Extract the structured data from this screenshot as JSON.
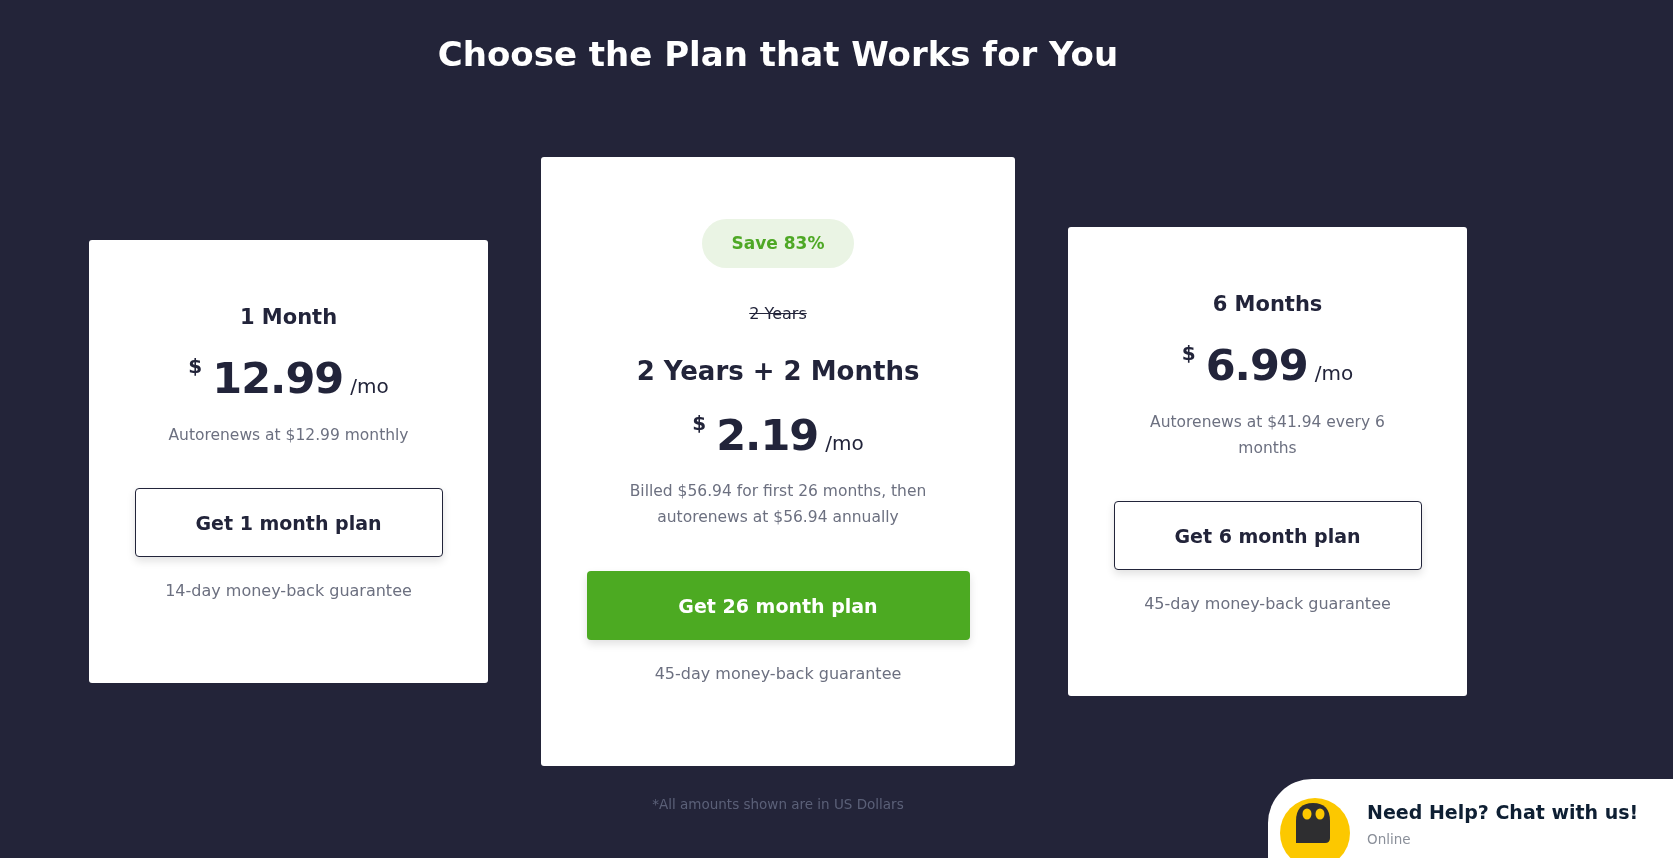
{
  "page": {
    "title": "Choose the Plan that Works for You"
  },
  "plans": [
    {
      "featured": false,
      "name": "1 Month",
      "currency": "$",
      "price": "12.99",
      "period": "/mo",
      "billing": "Autorenews at $12.99 monthly",
      "button": "Get 1 month plan",
      "guarantee": "14-day money-back guarantee"
    },
    {
      "featured": true,
      "badge": "Save 83%",
      "old_name": "2 Years",
      "name": "2 Years + 2 Months",
      "currency": "$",
      "price": "2.19",
      "period": "/mo",
      "billing": "Billed $56.94 for first 26 months, then autorenews at $56.94 annually",
      "button": "Get 26 month plan",
      "guarantee": "45-day money-back guarantee"
    },
    {
      "featured": false,
      "name": "6 Months",
      "currency": "$",
      "price": "6.99",
      "period": "/mo",
      "billing": "Autorenews at $41.94 every 6 months",
      "button": "Get 6 month plan",
      "guarantee": "45-day money-back guarantee"
    }
  ],
  "footnote": "*All amounts shown are in US Dollars",
  "chat": {
    "title": "Need Help? Chat with us!",
    "status": "Online"
  }
}
